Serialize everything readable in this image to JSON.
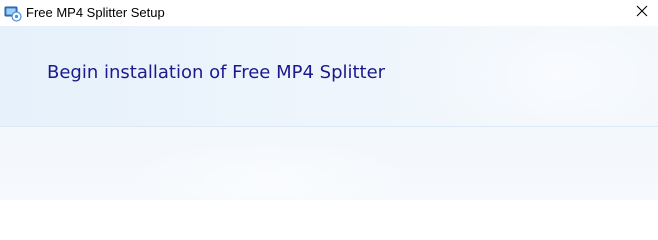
{
  "window": {
    "title": "Free MP4 Splitter Setup",
    "app_icon": "installer-app-icon",
    "close_icon": "close-icon"
  },
  "main": {
    "heading": "Begin installation of Free MP4 Splitter"
  },
  "colors": {
    "heading_text": "#1a1a8c",
    "background": "#eaf3fc"
  }
}
